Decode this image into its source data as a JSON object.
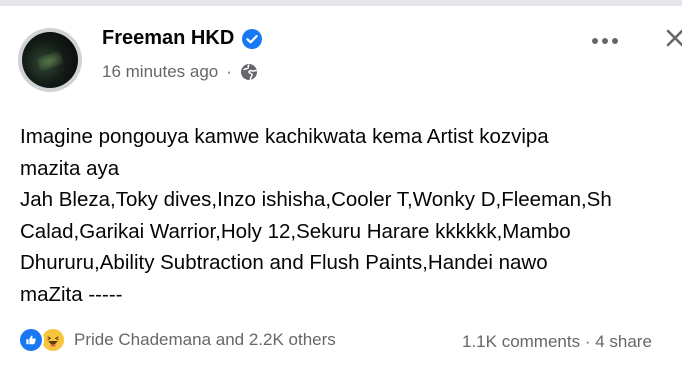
{
  "post": {
    "author": "Freeman HKD",
    "time": "16 minutes ago",
    "separator": "·",
    "text_lines": [
      "Imagine pongouya kamwe kachikwata kema Artist kozvipa",
      "mazita aya",
      "Jah Bleza,Toky dives,Inzo ishisha,Cooler T,Wonky D,Fleeman,Sh",
      "Calad,Garikai Warrior,Holy 12,Sekuru Harare kkkkkk,Mambo",
      "Dhururu,Ability Subtraction  and Flush Paints,Handei nawo",
      "maZita -----"
    ]
  },
  "footer": {
    "reactions_text": "Pride Chademana and 2.2K others",
    "comments_text": "1.1K comments · 4 share"
  },
  "icons": {
    "verified": "verified-badge-icon",
    "privacy": "globe-icon",
    "more": "more-options-icon",
    "close": "close-icon",
    "like": "like-reaction-icon",
    "haha": "haha-reaction-icon"
  },
  "colors": {
    "brand_blue": "#1877f2",
    "secondary_text": "#65676b",
    "primary_text": "#050505"
  }
}
